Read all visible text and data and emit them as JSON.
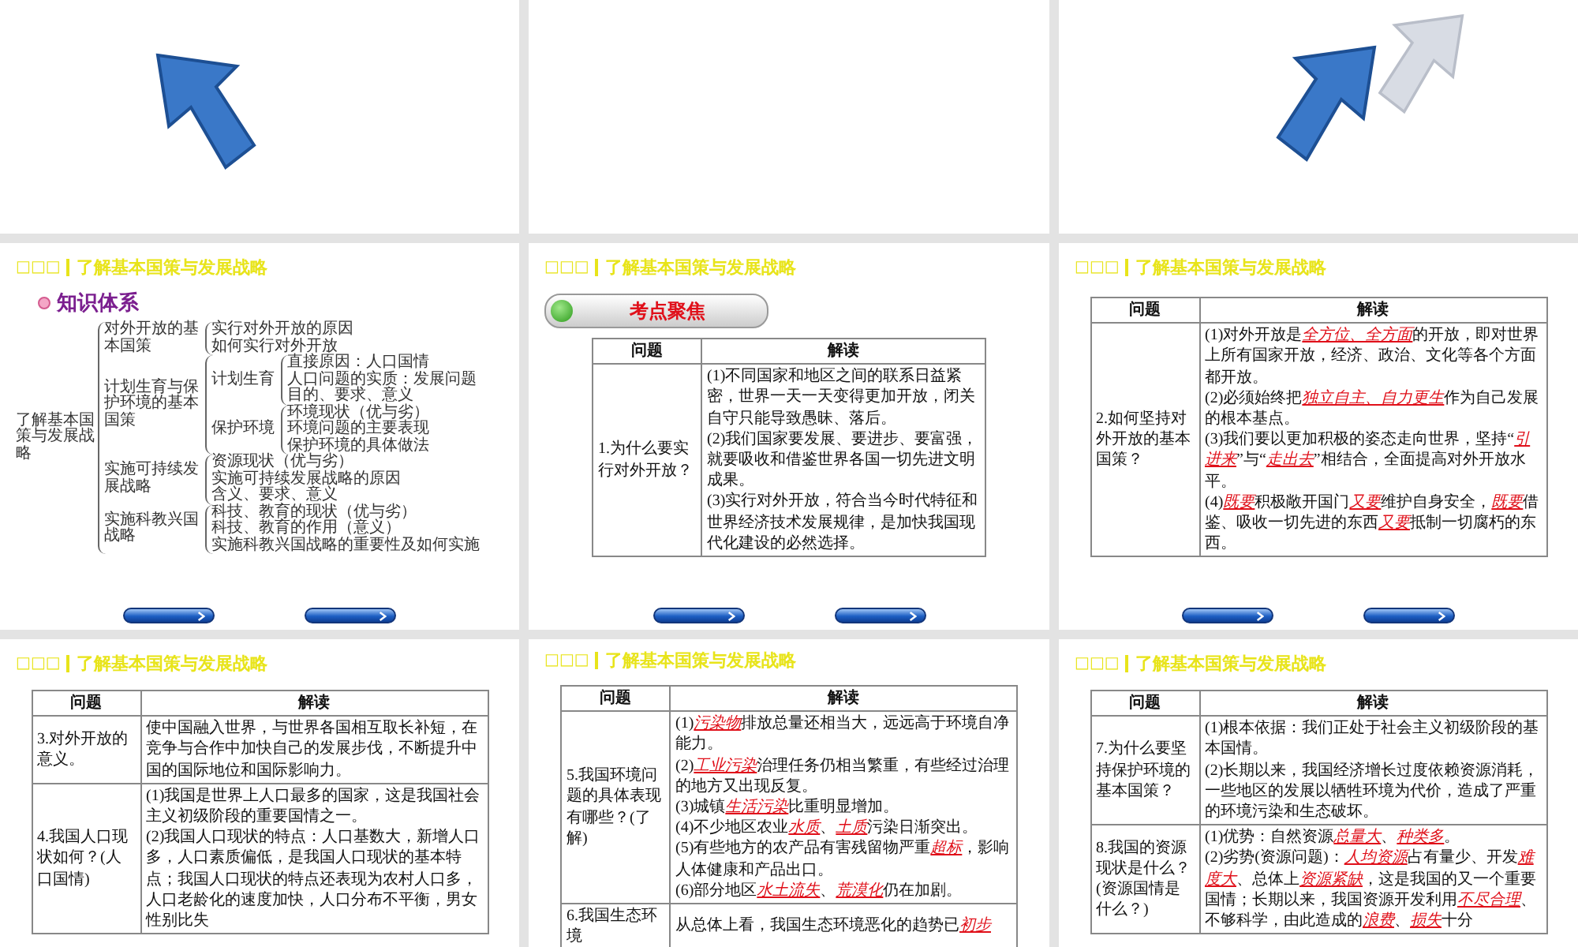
{
  "slides": [
    {
      "kind": "tree",
      "header": {
        "marks": "□□□",
        "title": "了解基本国策与发展战略"
      },
      "heading": "知识体系",
      "nav_buttons": true,
      "tree": {
        "label": "了解基本国策与发展战略",
        "children": [
          {
            "label": "对外开放的基本国策",
            "children": [
              {
                "label": "实行对外开放的原因"
              },
              {
                "label": "如何实行对外开放"
              }
            ]
          },
          {
            "label": "计划生育与保护环境的基本国策",
            "children": [
              {
                "label": "计划生育",
                "children": [
                  {
                    "label": "直接原因：人口国情"
                  },
                  {
                    "label": "人口问题的实质：发展问题"
                  },
                  {
                    "label": "目的、要求、意义"
                  }
                ]
              },
              {
                "label": "保护环境",
                "children": [
                  {
                    "label": "环境现状（优与劣）"
                  },
                  {
                    "label": "环境问题的主要表现"
                  },
                  {
                    "label": "保护环境的具体做法"
                  }
                ]
              }
            ]
          },
          {
            "label": "实施可持续发展战略",
            "children": [
              {
                "label": "资源现状（优与劣）"
              },
              {
                "label": "实施可持续发展战略的原因"
              },
              {
                "label": "含义、要求、意义"
              }
            ]
          },
          {
            "label": "实施科教兴国战略",
            "children": [
              {
                "label": "科技、教育的现状（优与劣）"
              },
              {
                "label": "科技、教育的作用（意义）"
              },
              {
                "label": "实施科教兴国战略的重要性及如何实施"
              }
            ]
          }
        ]
      }
    },
    {
      "kind": "table",
      "header": {
        "marks": "□□□",
        "title": "了解基本国策与发展战略"
      },
      "banner": "考点聚焦",
      "nav_buttons": true,
      "table": {
        "columns": [
          "问题",
          "解读"
        ],
        "rows": [
          {
            "question": "1.为什么要实行对外开放？",
            "answer": [
              "(1)不同国家和地区之间的联系日益紧密，世界一天一天变得更加开放，闭关自守只能导致愚昧、落后。",
              "(2)我们国家要发展、要进步、要富强，就要吸收和借鉴世界各国一切先进文明成果。",
              "(3)实行对外开放，符合当今时代特征和世界经济技术发展规律，是加快我国现代化建设的必然选择。"
            ]
          }
        ]
      }
    },
    {
      "kind": "table",
      "header": {
        "marks": "□□□",
        "title": "了解基本国策与发展战略"
      },
      "nav_buttons": true,
      "table": {
        "columns": [
          "问题",
          "解读"
        ],
        "rows": [
          {
            "question": "2.如何坚持对外开放的基本国策？",
            "answer": [
              "(1)对外开放是**全方位、全方面**的开放，即对世界上所有国家开放，经济、政治、文化等各个方面都开放。",
              "(2)必须始终把**独立自主、自力更生**作为自己发展的根本基点。",
              "(3)我们要以更加积极的姿态走向世界，坚持“**引进来**”与“**走出去**”相结合，全面提高对外开放水平。",
              "(4)**既要**积极敞开国门**又要**维护自身安全，**既要**借鉴、吸收一切先进的东西**又要**抵制一切腐朽的东西。"
            ]
          }
        ]
      }
    },
    {
      "kind": "table",
      "header": {
        "marks": "□□□",
        "title": "了解基本国策与发展战略"
      },
      "table": {
        "columns": [
          "问题",
          "解读"
        ],
        "rows": [
          {
            "question": "3.对外开放的意义。",
            "answer": [
              "使中国融入世界，与世界各国相互取长补短，在竞争与合作中加快自己的发展步伐，不断提升中国的国际地位和国际影响力。"
            ]
          },
          {
            "question": "4.我国人口现状如何？(人口国情)",
            "answer": [
              "(1)我国是世界上人口最多的国家，这是我国社会主义初级阶段的重要国情之一。",
              "(2)我国人口现状的特点：人口基数大，新增人口多，人口素质偏低，是我国人口现状的基本特点；我国人口现状的特点还表现为农村人口多，人口老龄化的速度加快，人口分布不平衡，男女性别比失"
            ]
          }
        ]
      }
    },
    {
      "kind": "table",
      "header": {
        "marks": "□□□",
        "title": "了解基本国策与发展战略"
      },
      "table": {
        "columns": [
          "问题",
          "解读"
        ],
        "rows": [
          {
            "question": "5.我国环境问题的具体表现有哪些？(了解)",
            "answer": [
              "(1)**污染物**排放总量还相当大，远远高于环境自净能力。",
              "(2)**工业污染**治理任务仍相当繁重，有些经过治理的地方又出现反复。",
              "(3)城镇**生活污染**比重明显增加。",
              "(4)不少地区农业**水质**、**土质**污染日渐突出。",
              "(5)有些地方的农产品有害残留物严重**超标**，影响人体健康和产品出口。",
              "(6)部分地区**水土流失**、**荒漠化**仍在加剧。"
            ]
          },
          {
            "question": "6.我国生态环境",
            "answer": [
              "从总体上看，我国生态环境恶化的趋势已**初步**"
            ]
          }
        ]
      }
    },
    {
      "kind": "table",
      "header": {
        "marks": "□□□",
        "title": "了解基本国策与发展战略"
      },
      "table": {
        "columns": [
          "问题",
          "解读"
        ],
        "rows": [
          {
            "question": "7.为什么要坚持保护环境的基本国策？",
            "answer": [
              "(1)根本依据：我们正处于社会主义初级阶段的基本国情。",
              "(2)长期以来，我国经济增长过度依赖资源消耗，一些地区的发展以牺牲环境为代价，造成了严重的环境污染和生态破坏。"
            ]
          },
          {
            "question": "8.我国的资源现状是什么？(资源国情是什么？)",
            "answer": [
              "(1)优势：自然资源**总量大**、**种类多**。",
              "(2)劣势(资源问题)：**人均资源**占有量少、开发**难度大**、总体上**资源紧缺**，这是我国的又一个重要国情；长期以来，我国资源开发利用**不尽合理**、不够科学，由此造成的**浪费**、**损失**十分"
            ]
          }
        ]
      }
    }
  ]
}
